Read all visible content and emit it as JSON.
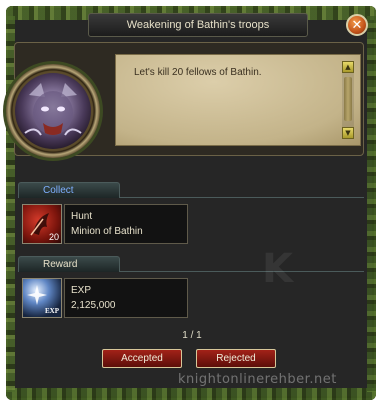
{
  "window": {
    "title": "Weakening of Bathin's troops",
    "close_icon": "close-icon"
  },
  "dialog": {
    "text": "Let's kill 20 fellows of Bathin.",
    "scroll_up_icon": "arrow-up-icon",
    "scroll_down_icon": "arrow-down-icon"
  },
  "portrait": {
    "icon": "monster-portrait"
  },
  "collect": {
    "label": "Collect",
    "item": {
      "icon": "hunt-icon",
      "count": "20",
      "name": "Hunt",
      "target": "Minion of Bathin"
    }
  },
  "reward": {
    "label": "Reward",
    "item": {
      "icon": "exp-icon",
      "tag": "EXP",
      "name": "EXP",
      "amount": "2,125,000"
    }
  },
  "pagination": {
    "text": "1 / 1"
  },
  "buttons": {
    "accepted": "Accepted",
    "rejected": "Rejected"
  },
  "watermark": {
    "logo_letter": "K",
    "site": "knightonlinerehber.net"
  },
  "colors": {
    "collect_label": "#7fb0ff",
    "button_red": "#a32218",
    "parchment": "#c3b389"
  }
}
